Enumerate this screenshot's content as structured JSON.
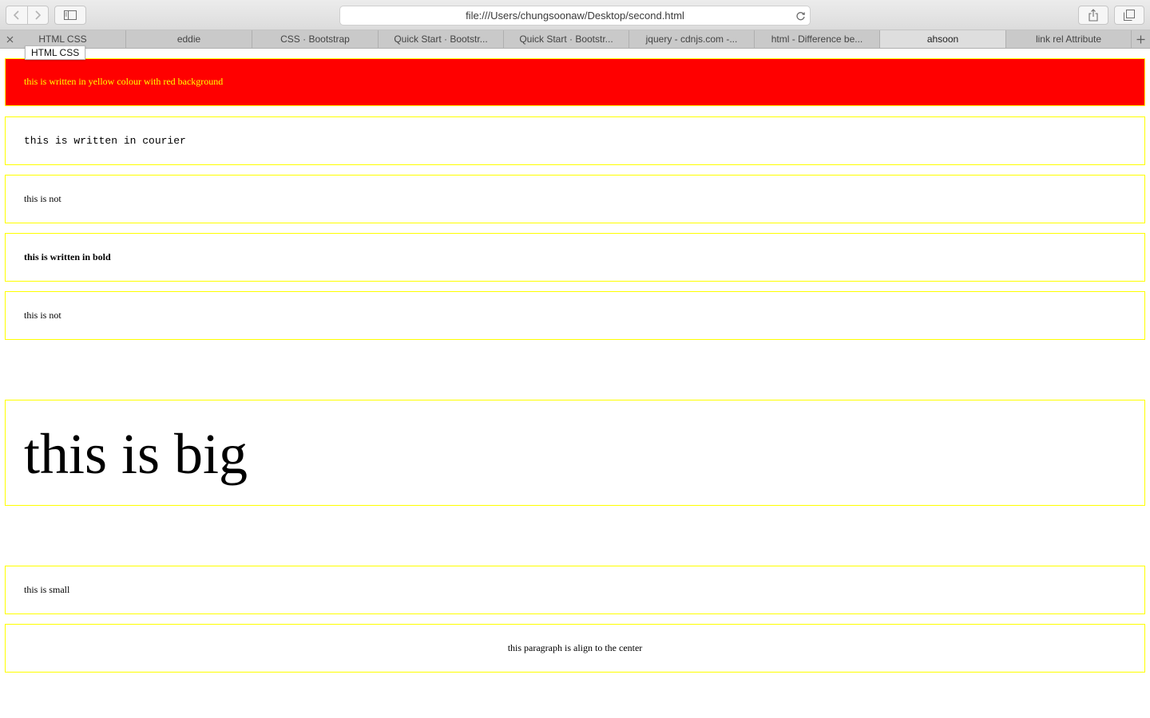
{
  "browser": {
    "address": "file:///Users/chungsoonaw/Desktop/second.html",
    "tabs": [
      {
        "label": "HTML CSS",
        "active": false
      },
      {
        "label": "eddie",
        "active": false
      },
      {
        "label": "CSS · Bootstrap",
        "active": false
      },
      {
        "label": "Quick Start · Bootstr...",
        "active": false
      },
      {
        "label": "Quick Start · Bootstr...",
        "active": false
      },
      {
        "label": "jquery - cdnjs.com -...",
        "active": false
      },
      {
        "label": "html - Difference be...",
        "active": false
      },
      {
        "label": "ahsoon",
        "active": true
      },
      {
        "label": "link rel Attribute",
        "active": false
      }
    ],
    "tooltip": "HTML CSS",
    "icons": {
      "back": "chevron-left-icon",
      "forward": "chevron-right-icon",
      "sidebar": "sidebar-icon",
      "reload": "reload-icon",
      "share": "share-icon",
      "tabs_overview": "tab-overview-icon",
      "close_tab": "close-icon",
      "new_tab": "plus-icon"
    }
  },
  "page": {
    "paragraphs": [
      {
        "text": "this is written in yellow colour with red background"
      },
      {
        "text": "this is written in courier"
      },
      {
        "text": "this is not"
      },
      {
        "text": "this is written in bold"
      },
      {
        "text": "this is not"
      },
      {
        "text": "this is big"
      },
      {
        "text": "this is small"
      },
      {
        "text": "this paragraph is align to the center"
      }
    ]
  },
  "colors": {
    "paragraph_border": "#ffff00",
    "highlight_background": "#ff0000",
    "highlight_text": "#ffff00"
  }
}
